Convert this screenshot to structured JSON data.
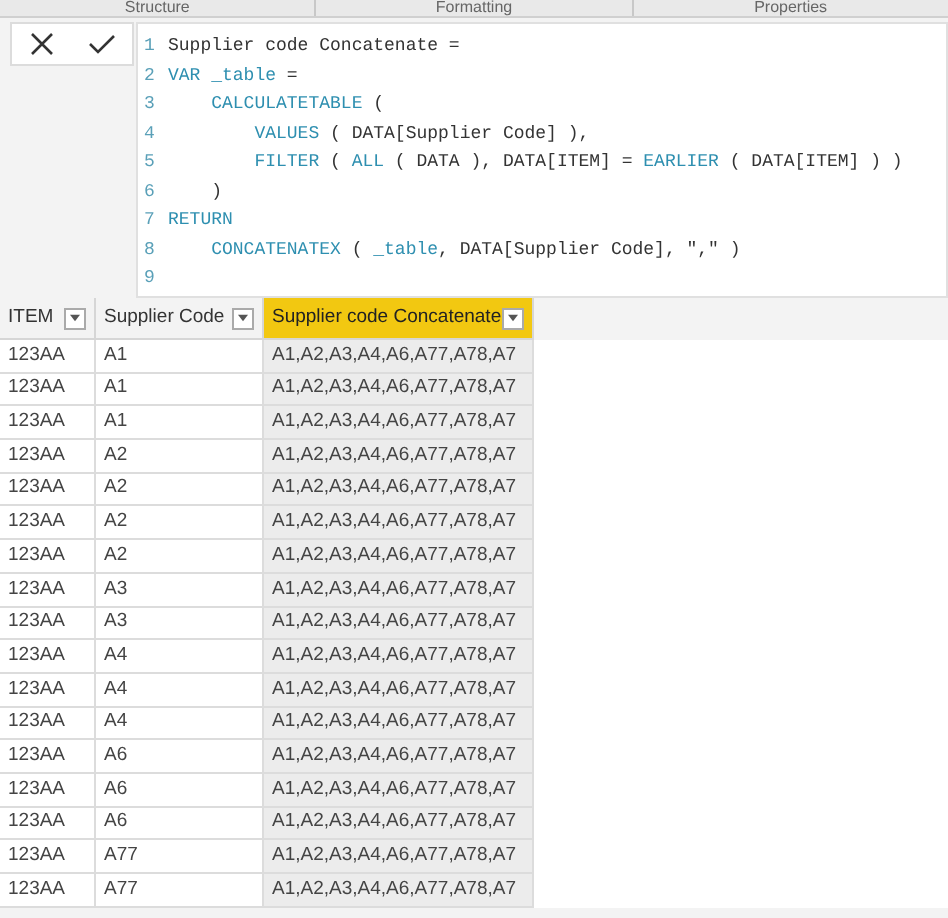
{
  "ribbon_groups": [
    "Structure",
    "Formatting",
    "Properties"
  ],
  "formula_bar": {
    "code_lines": [
      {
        "number": "1",
        "tokens": [
          {
            "kind": "text",
            "text": "Supplier code Concatenate ="
          }
        ]
      },
      {
        "number": "2",
        "tokens": [
          {
            "kind": "keyword",
            "text": "VAR"
          },
          {
            "kind": "keyword",
            "text": " _table"
          },
          {
            "kind": "text",
            "text": " ="
          }
        ]
      },
      {
        "number": "3",
        "tokens": [
          {
            "kind": "keyword",
            "text": "    CALCULATETABLE"
          },
          {
            "kind": "text",
            "text": " ("
          }
        ]
      },
      {
        "number": "4",
        "tokens": [
          {
            "kind": "keyword",
            "text": "        VALUES"
          },
          {
            "kind": "text",
            "text": " ( DATA[Supplier Code] ),"
          }
        ]
      },
      {
        "number": "5",
        "tokens": [
          {
            "kind": "keyword",
            "text": "        FILTER"
          },
          {
            "kind": "text",
            "text": " ( "
          },
          {
            "kind": "keyword",
            "text": "ALL"
          },
          {
            "kind": "text",
            "text": " ( DATA ), DATA[ITEM] = "
          },
          {
            "kind": "keyword",
            "text": "EARLIER"
          },
          {
            "kind": "text",
            "text": " ( DATA[ITEM] ) )"
          }
        ]
      },
      {
        "number": "6",
        "tokens": [
          {
            "kind": "text",
            "text": "    )"
          }
        ]
      },
      {
        "number": "7",
        "tokens": [
          {
            "kind": "keyword",
            "text": "RETURN"
          }
        ]
      },
      {
        "number": "8",
        "tokens": [
          {
            "kind": "keyword",
            "text": "    CONCATENATEX"
          },
          {
            "kind": "text",
            "text": " ( "
          },
          {
            "kind": "keyword",
            "text": "_table"
          },
          {
            "kind": "text",
            "text": ", DATA[Supplier Code], \",\" )"
          }
        ]
      },
      {
        "number": "9"
      }
    ]
  },
  "table": {
    "columns": [
      {
        "label": "ITEM",
        "selected": false
      },
      {
        "label": "Supplier Code",
        "selected": false
      },
      {
        "label": "Supplier code Concatenate",
        "selected": true
      }
    ],
    "rows": [
      [
        "123AA",
        "A1",
        "A1,A2,A3,A4,A6,A77,A78,A7"
      ],
      [
        "123AA",
        "A1",
        "A1,A2,A3,A4,A6,A77,A78,A7"
      ],
      [
        "123AA",
        "A1",
        "A1,A2,A3,A4,A6,A77,A78,A7"
      ],
      [
        "123AA",
        "A2",
        "A1,A2,A3,A4,A6,A77,A78,A7"
      ],
      [
        "123AA",
        "A2",
        "A1,A2,A3,A4,A6,A77,A78,A7"
      ],
      [
        "123AA",
        "A2",
        "A1,A2,A3,A4,A6,A77,A78,A7"
      ],
      [
        "123AA",
        "A2",
        "A1,A2,A3,A4,A6,A77,A78,A7"
      ],
      [
        "123AA",
        "A3",
        "A1,A2,A3,A4,A6,A77,A78,A7"
      ],
      [
        "123AA",
        "A3",
        "A1,A2,A3,A4,A6,A77,A78,A7"
      ],
      [
        "123AA",
        "A4",
        "A1,A2,A3,A4,A6,A77,A78,A7"
      ],
      [
        "123AA",
        "A4",
        "A1,A2,A3,A4,A6,A77,A78,A7"
      ],
      [
        "123AA",
        "A4",
        "A1,A2,A3,A4,A6,A77,A78,A7"
      ],
      [
        "123AA",
        "A6",
        "A1,A2,A3,A4,A6,A77,A78,A7"
      ],
      [
        "123AA",
        "A6",
        "A1,A2,A3,A4,A6,A77,A78,A7"
      ],
      [
        "123AA",
        "A6",
        "A1,A2,A3,A4,A6,A77,A78,A7"
      ],
      [
        "123AA",
        "A77",
        "A1,A2,A3,A4,A6,A77,A78,A7"
      ],
      [
        "123AA",
        "A77",
        "A1,A2,A3,A4,A6,A77,A78,A7"
      ]
    ]
  }
}
